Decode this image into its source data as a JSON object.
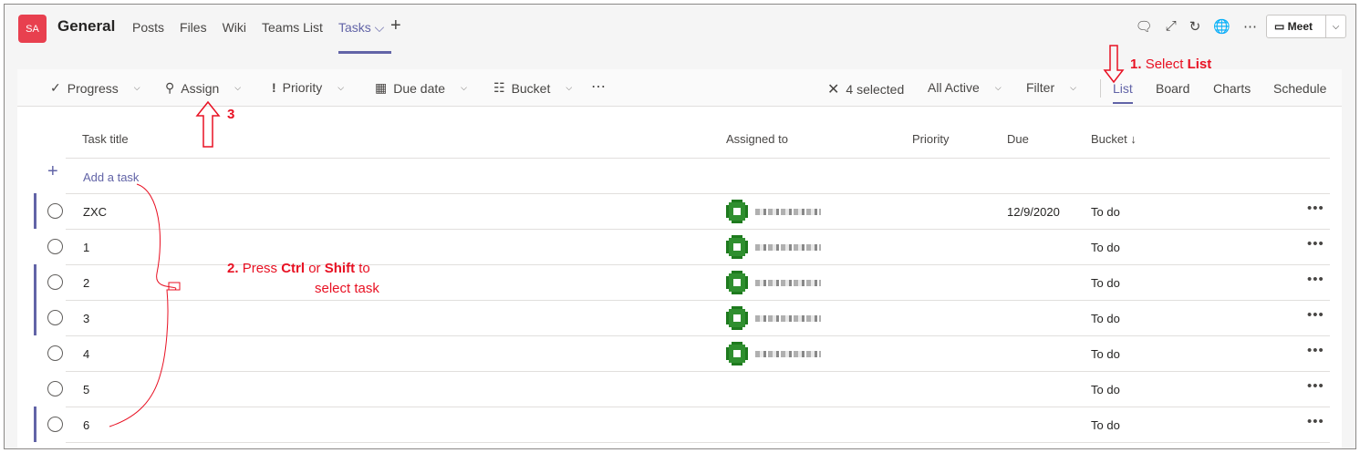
{
  "header": {
    "avatar": "SA",
    "channel": "General",
    "tabs": [
      {
        "label": "Posts"
      },
      {
        "label": "Files"
      },
      {
        "label": "Wiki"
      },
      {
        "label": "Teams List"
      },
      {
        "label": "Tasks ⌵"
      }
    ],
    "meet_label": "Meet"
  },
  "toolbar": {
    "progress": "Progress",
    "assign": "Assign",
    "priority": "Priority",
    "due_date": "Due date",
    "bucket": "Bucket",
    "selected": "4 selected",
    "all_active": "All Active",
    "filter": "Filter",
    "views": {
      "list": "List",
      "board": "Board",
      "charts": "Charts",
      "schedule": "Schedule"
    }
  },
  "columns": {
    "title": "Task title",
    "assigned": "Assigned to",
    "priority": "Priority",
    "due": "Due",
    "bucket": "Bucket ↓"
  },
  "add_task": "Add a task",
  "tasks": [
    {
      "title": "ZXC",
      "due": "12/9/2020",
      "bucket": "To do",
      "selected": true
    },
    {
      "title": "1",
      "due": "",
      "bucket": "To do",
      "selected": false
    },
    {
      "title": "2",
      "due": "",
      "bucket": "To do",
      "selected": true
    },
    {
      "title": "3",
      "due": "",
      "bucket": "To do",
      "selected": true
    },
    {
      "title": "4",
      "due": "",
      "bucket": "To do",
      "selected": false
    },
    {
      "title": "5",
      "due": "",
      "bucket": "To do",
      "selected": false
    },
    {
      "title": "6",
      "due": "",
      "bucket": "To do",
      "selected": true
    }
  ],
  "annotations": {
    "step1_num": "1.",
    "step1_text": "Select",
    "step1_bold": "List",
    "step2_num": "2.",
    "step2_a": "Press",
    "step2_ctrl": "Ctrl",
    "step2_or": "or",
    "step2_shift": "Shift",
    "step2_to": "to",
    "step2_line2": "select task",
    "step3": "3"
  },
  "colors": {
    "accent": "#6264a7",
    "annotation": "#e81123",
    "avatar": "#e8404f"
  }
}
